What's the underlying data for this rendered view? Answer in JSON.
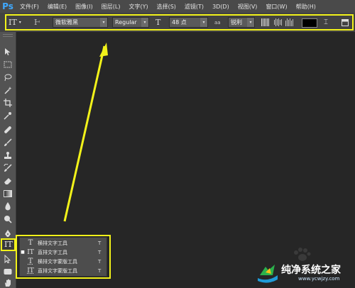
{
  "app": {
    "logo": "Ps"
  },
  "menubar": [
    "文件(F)",
    "编辑(E)",
    "图像(I)",
    "图层(L)",
    "文字(Y)",
    "选择(S)",
    "滤镜(T)",
    "3D(D)",
    "视图(V)",
    "窗口(W)",
    "帮助(H)"
  ],
  "options": {
    "tool_icon": "IT",
    "font_family": "微软雅黑",
    "font_style": "Regular",
    "font_size": "48 点",
    "aa_icon": "aa",
    "anti_alias": "锐利",
    "color": "#000000"
  },
  "flyout": {
    "items": [
      {
        "label": "横排文字工具",
        "shortcut": "T",
        "icon": "T",
        "selected": false
      },
      {
        "label": "直排文字工具",
        "shortcut": "T",
        "icon": "IT",
        "selected": true
      },
      {
        "label": "横排文字蒙版工具",
        "shortcut": "T",
        "icon": "T",
        "selected": false
      },
      {
        "label": "直排文字蒙版工具",
        "shortcut": "T",
        "icon": "IT",
        "selected": false
      }
    ]
  },
  "watermark": {
    "title": "纯净系统之家",
    "url": "www.ycwjzy.com"
  },
  "colors": {
    "highlight": "#f2f21a",
    "ps_blue": "#3fa9ff"
  }
}
